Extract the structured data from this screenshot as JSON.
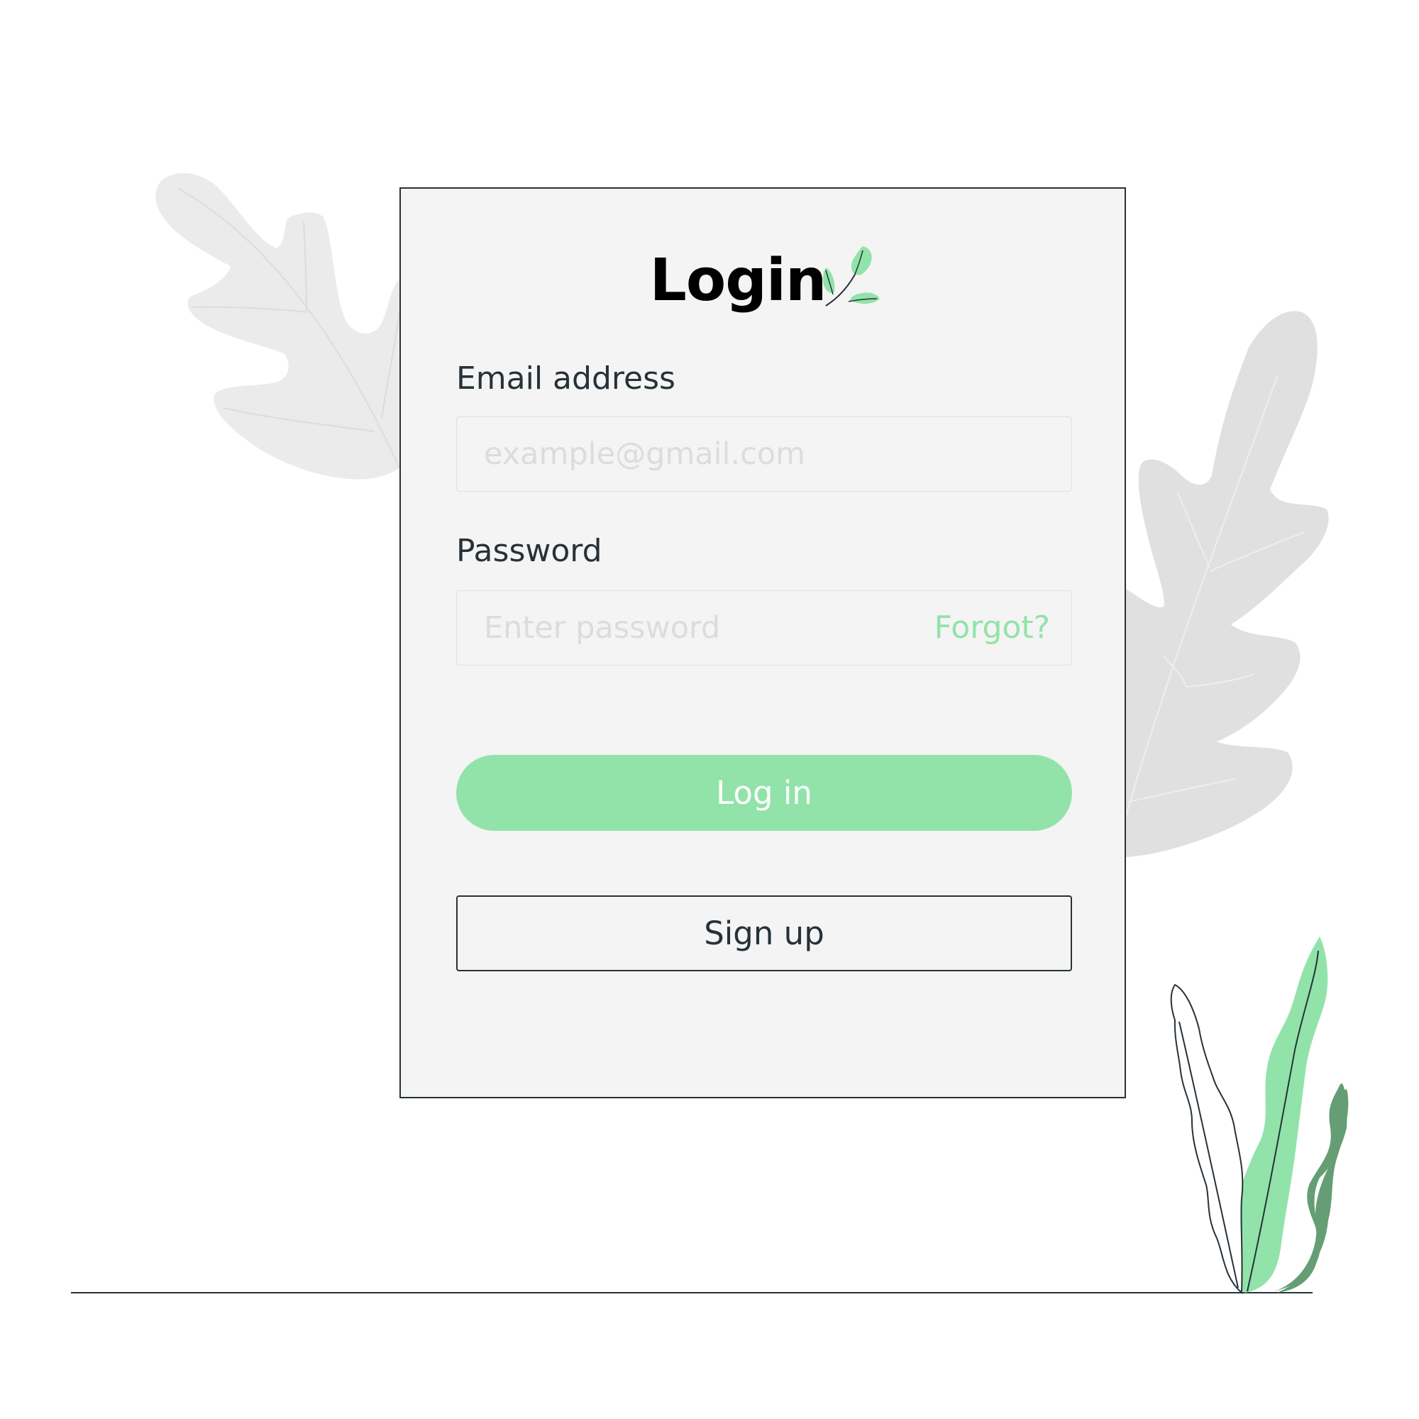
{
  "page": {
    "title": "Login"
  },
  "form": {
    "email": {
      "label": "Email address",
      "placeholder": "example@gmail.com",
      "value": ""
    },
    "password": {
      "label": "Password",
      "placeholder": "Enter password",
      "value": "",
      "forgot_label": "Forgot?"
    },
    "login_label": "Log in",
    "signup_label": "Sign up"
  },
  "icons": {
    "title_icon": "leaf-sprig-icon",
    "background": [
      "oak-leaf-icon",
      "oak-leaf-icon",
      "plant-icon"
    ]
  },
  "colors": {
    "accent": "#92e3a9",
    "accent_dark": "#659e74",
    "text": "#263238",
    "card_bg": "#f4f4f4",
    "leaf_bg_light": "#ebebeb",
    "leaf_bg_dark": "#e0e0e0"
  }
}
